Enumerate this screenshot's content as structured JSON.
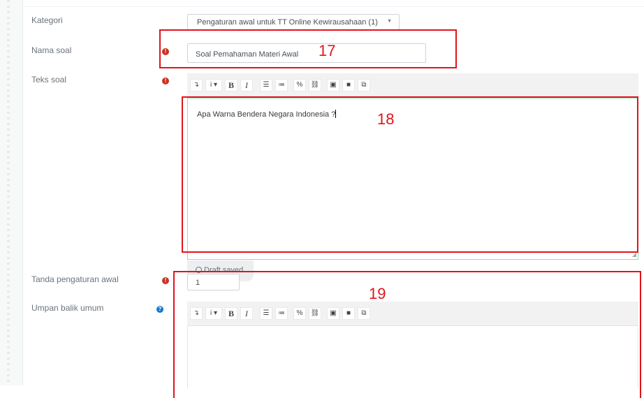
{
  "form": {
    "kategori": {
      "label": "Kategori",
      "selected": "Pengaturan awal untuk TT Online Kewirausahaan (1)"
    },
    "nama_soal": {
      "label": "Nama soal",
      "value": "Soal Pemahaman Materi Awal"
    },
    "teks_soal": {
      "label": "Teks soal",
      "content": "Apa Warna Bendera Negara Indonesia ?"
    },
    "draft_status": "Draft saved",
    "tanda_pengaturan_awal": {
      "label": "Tanda pengaturan awal",
      "value": "1"
    },
    "umpan_balik_umum": {
      "label": "Umpan balik umum",
      "content": ""
    }
  },
  "toolbar_buttons": [
    "collapse-icon",
    "paragraph-styles-icon",
    "bold-icon",
    "italic-icon",
    "unordered-list-icon",
    "ordered-list-icon",
    "link-icon",
    "unlink-icon",
    "image-icon",
    "media-icon",
    "manage-files-icon"
  ],
  "annotations": [
    "17",
    "18",
    "19"
  ],
  "colors": {
    "required": "#ca3120",
    "help": "#1177d1",
    "annotation": "#e1141b",
    "editor_focus": "#8ee0b6"
  }
}
